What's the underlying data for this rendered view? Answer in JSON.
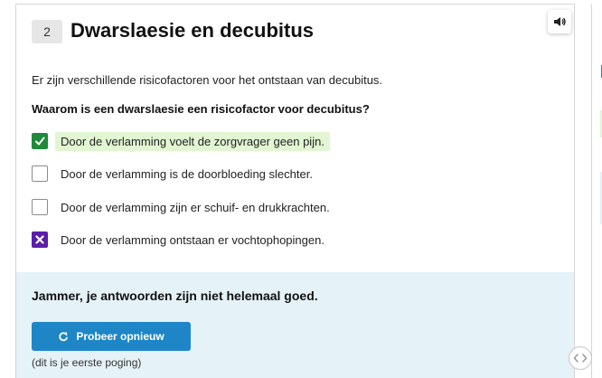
{
  "question": {
    "number": "2",
    "title": "Dwarslaesie en decubitus",
    "intro": "Er zijn verschillende risicofactoren voor het ontstaan van decubitus.",
    "prompt": "Waarom is een dwarslaesie een risicofactor voor decubitus?",
    "options": [
      {
        "label": "Door de verlamming voelt de zorgvrager geen pijn.",
        "state": "correct"
      },
      {
        "label": "Door de verlamming is de doorbloeding slechter.",
        "state": "unchecked"
      },
      {
        "label": "Door de verlamming zijn er schuif- en drukkrachten.",
        "state": "unchecked"
      },
      {
        "label": "Door de verlamming ontstaan er vochtophopingen.",
        "state": "wrong"
      }
    ]
  },
  "feedback": {
    "message": "Jammer, je antwoorden zijn niet helemaal goed.",
    "retry_label": "Probeer opnieuw",
    "attempt_note": "(dit is je eerste poging)"
  },
  "colors": {
    "correct": "#1f8a3a",
    "wrong": "#5b1fa8",
    "highlight": "#e2f6d3",
    "feedback_bg": "#e5f2f8",
    "button": "#1e86c7"
  },
  "icons": {
    "audio": "speaker-icon",
    "retry": "refresh-icon",
    "correct": "check-icon",
    "wrong": "cross-icon",
    "scroll": "chevrons-left-right-icon"
  }
}
